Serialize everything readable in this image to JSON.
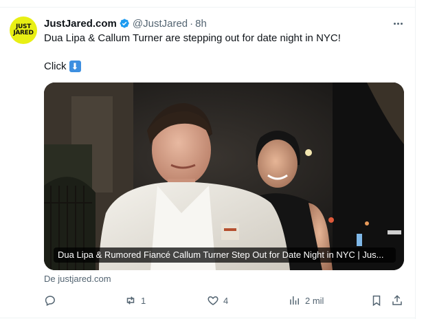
{
  "tweet": {
    "display_name": "JustJared.com",
    "handle": "@JustJared",
    "separator": "·",
    "time": "8h",
    "text_line1": "Dua Lipa & Callum Turner are stepping out for date night in NYC!",
    "text_line2": "Click",
    "arrow_glyph": "⬇"
  },
  "avatar": {
    "line1": "JUST",
    "line2": "JARED",
    "color": "#e8ef14"
  },
  "card": {
    "caption": "Dua Lipa & Rumored Fiancé Callum Turner Step Out for Date Night in NYC | Jus...",
    "source": "De justjared.com"
  },
  "actions": {
    "replies": "",
    "reposts": "1",
    "likes": "4",
    "views": "2 mil"
  },
  "icons": [
    "verified-badge-icon",
    "more-options-icon",
    "arrow-down-emoji-icon",
    "reply-icon",
    "repost-icon",
    "like-icon",
    "views-icon",
    "bookmark-icon",
    "share-icon"
  ],
  "colors": {
    "accent": "#1d9bf0",
    "secondary_text": "#536471",
    "text": "#0f1419"
  }
}
